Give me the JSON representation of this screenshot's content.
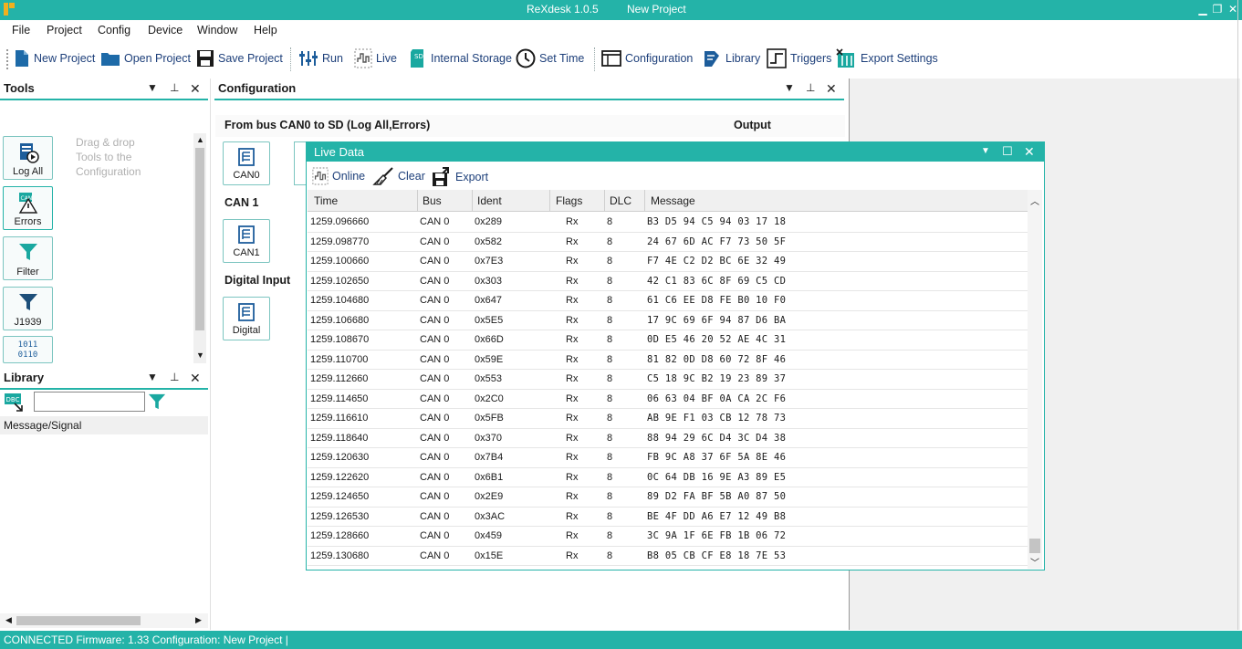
{
  "window": {
    "app_name": "ReXdesk 1.0.5",
    "project_name": "New Project",
    "minimize": "▁",
    "restore": "❐",
    "close": "✕"
  },
  "menu": [
    "File",
    "Project",
    "Config",
    "Device",
    "Window",
    "Help"
  ],
  "toolbar": {
    "new_project": "New Project",
    "open_project": "Open Project",
    "save_project": "Save Project",
    "run": "Run",
    "live": "Live",
    "internal_storage": "Internal Storage",
    "set_time": "Set Time",
    "configuration": "Configuration",
    "library": "Library",
    "triggers": "Triggers",
    "export_settings": "Export Settings"
  },
  "tools_panel": {
    "title": "Tools",
    "hint": "Drag & drop Tools to the Configuration",
    "items": [
      "Log All",
      "Errors",
      "Filter",
      "J1939"
    ],
    "errors_badge": "CAN",
    "binary_icon_top": "1011",
    "binary_icon_bottom": "0110"
  },
  "library_panel": {
    "title": "Library",
    "search_value": "",
    "dbc_badge": "DBC",
    "column": "Message/Signal"
  },
  "configuration_panel": {
    "title": "Configuration",
    "route": "From bus CAN0  to SD (Log All,Errors)",
    "output": "Output",
    "sections": [
      "CAN 1",
      "Digital Input"
    ],
    "boxes": [
      "CAN0",
      "CAN1",
      "Digital"
    ]
  },
  "live_data": {
    "title": "Live Data",
    "online": "Online",
    "clear": "Clear",
    "export": "Export",
    "columns": [
      "Time",
      "Bus",
      "Ident",
      "Flags",
      "DLC",
      "Message"
    ],
    "rows": [
      [
        "1259.096660",
        "CAN 0",
        "0x289",
        "Rx",
        "8",
        "B3 D5 94 C5 94 03 17 18"
      ],
      [
        "1259.098770",
        "CAN 0",
        "0x582",
        "Rx",
        "8",
        "24 67 6D AC F7 73 50 5F"
      ],
      [
        "1259.100660",
        "CAN 0",
        "0x7E3",
        "Rx",
        "8",
        "F7 4E C2 D2 BC 6E 32 49"
      ],
      [
        "1259.102650",
        "CAN 0",
        "0x303",
        "Rx",
        "8",
        "42 C1 83 6C 8F 69 C5 CD"
      ],
      [
        "1259.104680",
        "CAN 0",
        "0x647",
        "Rx",
        "8",
        "61 C6 EE D8 FE B0 10 F0"
      ],
      [
        "1259.106680",
        "CAN 0",
        "0x5E5",
        "Rx",
        "8",
        "17 9C 69 6F 94 87 D6 BA"
      ],
      [
        "1259.108670",
        "CAN 0",
        "0x66D",
        "Rx",
        "8",
        "0D E5 46 20 52 AE 4C 31"
      ],
      [
        "1259.110700",
        "CAN 0",
        "0x59E",
        "Rx",
        "8",
        "81 82 0D D8 60 72 8F 46"
      ],
      [
        "1259.112660",
        "CAN 0",
        "0x553",
        "Rx",
        "8",
        "C5 18 9C B2 19 23 89 37"
      ],
      [
        "1259.114650",
        "CAN 0",
        "0x2C0",
        "Rx",
        "8",
        "06 63 04 BF 0A CA 2C F6"
      ],
      [
        "1259.116610",
        "CAN 0",
        "0x5FB",
        "Rx",
        "8",
        "AB 9E F1 03 CB 12 78 73"
      ],
      [
        "1259.118640",
        "CAN 0",
        "0x370",
        "Rx",
        "8",
        "88 94 29 6C D4 3C D4 38"
      ],
      [
        "1259.120630",
        "CAN 0",
        "0x7B4",
        "Rx",
        "8",
        "FB 9C A8 37 6F 5A 8E 46"
      ],
      [
        "1259.122620",
        "CAN 0",
        "0x6B1",
        "Rx",
        "8",
        "0C 64 DB 16 9E A3 89 E5"
      ],
      [
        "1259.124650",
        "CAN 0",
        "0x2E9",
        "Rx",
        "8",
        "89 D2 FA BF 5B A0 87 50"
      ],
      [
        "1259.126530",
        "CAN 0",
        "0x3AC",
        "Rx",
        "8",
        "BE 4F DD A6 E7 12 49 B8"
      ],
      [
        "1259.128660",
        "CAN 0",
        "0x459",
        "Rx",
        "8",
        "3C 9A 1F 6E FB 1B 06 72"
      ],
      [
        "1259.130680",
        "CAN 0",
        "0x15E",
        "Rx",
        "8",
        "B8 05 CB CF E8 18 7E 53"
      ]
    ]
  },
  "status": "CONNECTED  Firmware: 1.33  Configuration: New Project  |",
  "colors": {
    "accent": "#24b3a8",
    "icon_blue": "#1d5d9b"
  }
}
